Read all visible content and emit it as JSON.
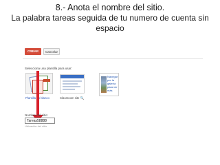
{
  "slide": {
    "title_line1": "8.- Anota el nombre del sitio.",
    "title_line2": "La palabra tareas seguida de tu numero de cuenta sin",
    "title_line3": "espacio"
  },
  "toolbar": {
    "create_label": "CREAR",
    "cancel_label": "Cancelar"
  },
  "templates": {
    "heading": "Selecciona una plantilla para usar:",
    "blank_caption": "Plantilla en blanco",
    "classroom_caption": "Classroom site",
    "browse_text": "Navegar por la galería para ver más"
  },
  "site_name": {
    "label": "Nombre del sitio:",
    "value": "Tareas58888",
    "hint": "Ubicación del sitio"
  },
  "colors": {
    "create_button": "#d44c3a",
    "arrow": "#d8202a",
    "link": "#2a57b8"
  }
}
